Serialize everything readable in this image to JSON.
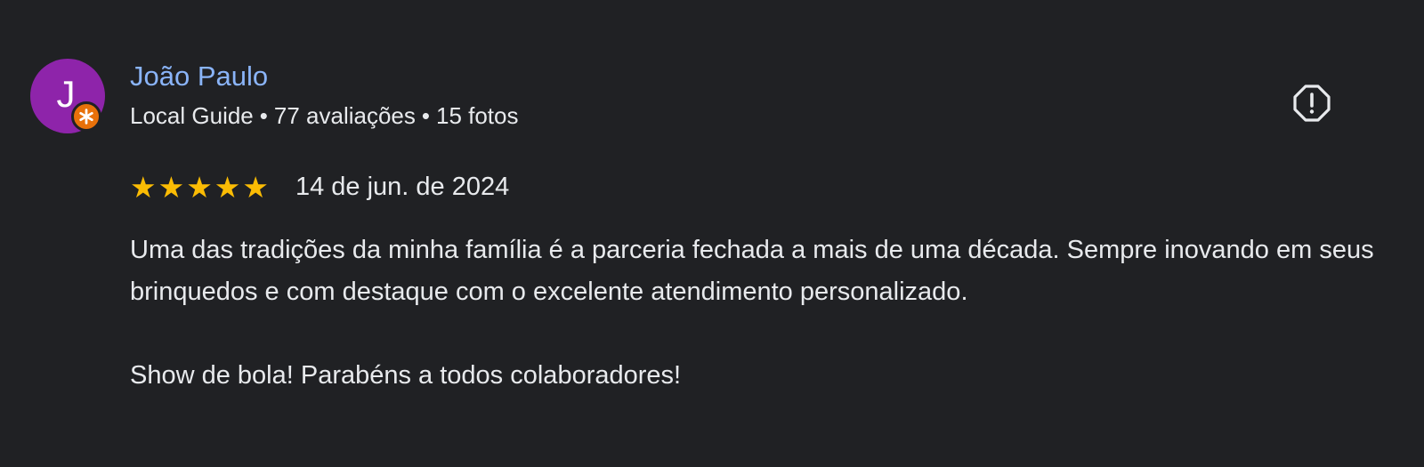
{
  "review": {
    "author": {
      "initial": "J",
      "name": "João Paulo",
      "badge_icon": "local-guide-badge-icon",
      "meta": {
        "local_guide": "Local Guide",
        "separator": "•",
        "reviews": "77 avaliações",
        "photos": "15 fotos"
      }
    },
    "rating": {
      "stars": 5,
      "max_stars": 5,
      "star_glyph": "★",
      "date": "14 de jun. de 2024"
    },
    "body": {
      "paragraph_1": "Uma das tradições da minha família é a parceria fechada a mais de uma década. Sempre inovando em seus brinquedos e com destaque com o excelente atendimento personalizado.",
      "paragraph_2": "Show de bola! Parabéns a todos colaboradores!"
    },
    "actions": {
      "flag_icon": "report-flag-icon"
    }
  },
  "colors": {
    "background": "#202124",
    "avatar": "#8e24aa",
    "badge": "#e8710a",
    "author_name": "#8ab4f8",
    "text": "#e8eaed",
    "star": "#fbbc04",
    "icon": "#e8eaed"
  }
}
